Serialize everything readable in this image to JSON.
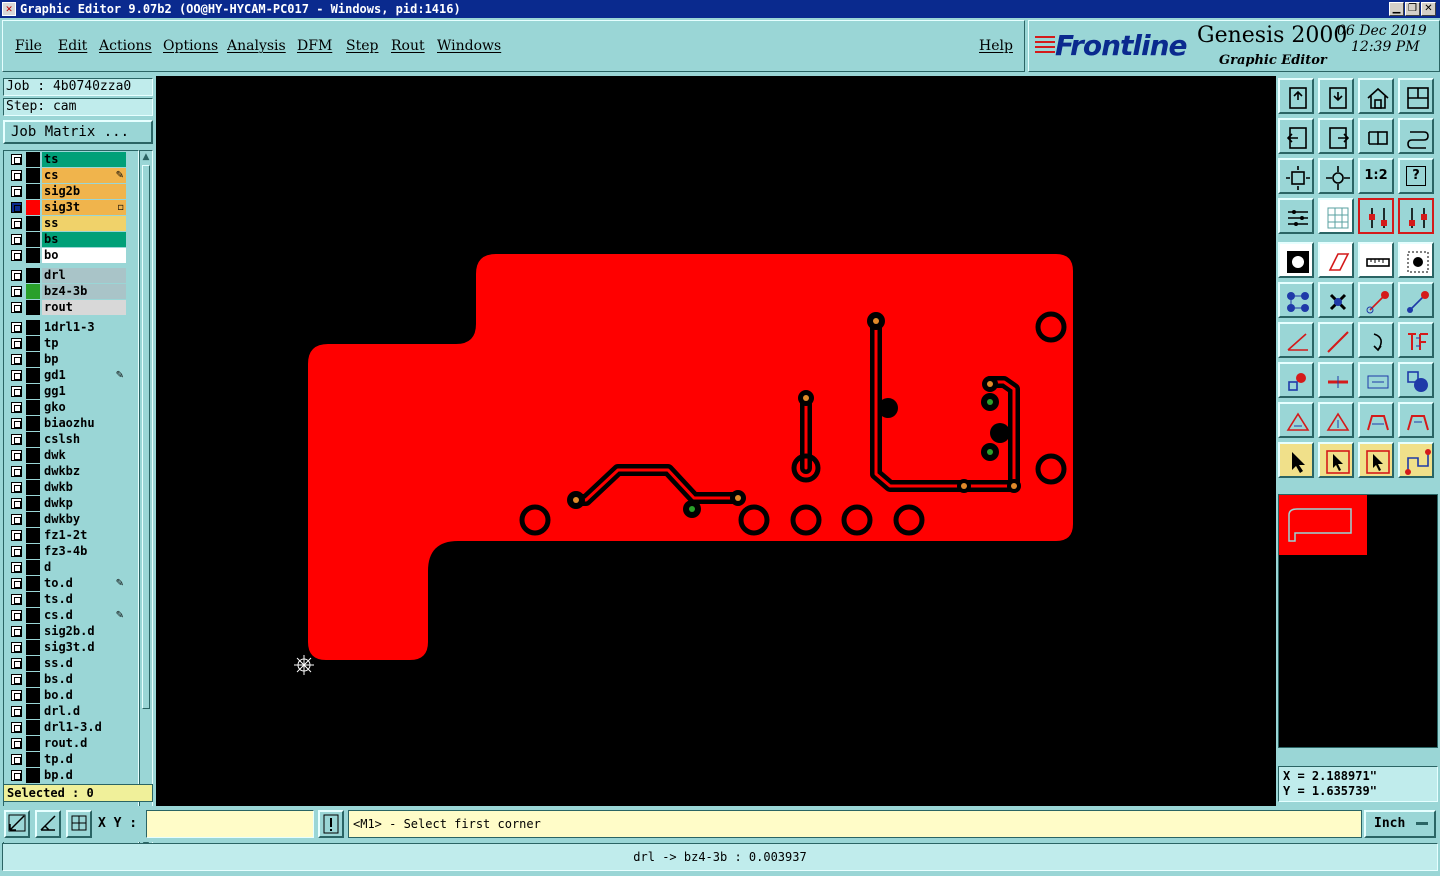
{
  "window": {
    "title": "Graphic Editor 9.07b2 (OO@HY-HYCAM-PC017 - Windows, pid:1416)",
    "buttons": [
      "minimize",
      "restore",
      "close"
    ]
  },
  "menu": {
    "items": [
      "File",
      "Edit",
      "Actions",
      "Options",
      "Analysis",
      "DFM",
      "Step",
      "Rout",
      "Windows"
    ],
    "help": "Help"
  },
  "brand": {
    "logo": "Frontline",
    "product": "Genesis 2000",
    "subtitle": "Graphic Editor",
    "date": "06 Dec 2019",
    "time": "12:39 PM"
  },
  "job": {
    "job_label": "Job : 4b0740zza0",
    "step_label": "Step: cam",
    "matrix_button": "Job Matrix ..."
  },
  "layers": [
    {
      "name": "ts",
      "bg": "#00a078",
      "swatch": "#000000",
      "mark": ""
    },
    {
      "name": "cs",
      "bg": "#f0b44c",
      "swatch": "#000000",
      "mark": "✎"
    },
    {
      "name": "sig2b",
      "bg": "#f0b44c",
      "swatch": "#000000",
      "mark": ""
    },
    {
      "name": "sig3t",
      "bg": "#f0b44c",
      "swatch": "#ff0000",
      "mark": "▫",
      "active": true
    },
    {
      "name": "ss",
      "bg": "#f0d26a",
      "swatch": "#000000",
      "mark": ""
    },
    {
      "name": "bs",
      "bg": "#00a078",
      "swatch": "#000000",
      "mark": ""
    },
    {
      "name": "bo",
      "bg": "#ffffff",
      "swatch": "#000000",
      "mark": ""
    },
    {
      "name": "drl",
      "bg": "#a9c4c8",
      "swatch": "#000000",
      "mark": "",
      "gap": true
    },
    {
      "name": "bz4-3b",
      "bg": "#a9c4c8",
      "swatch": "#2aa02a",
      "mark": ""
    },
    {
      "name": "rout",
      "bg": "#d8d8d8",
      "swatch": "#000000",
      "mark": ""
    },
    {
      "name": "1drl1-3",
      "bg": "#9ad6d6",
      "swatch": "#000000",
      "mark": "",
      "gap": true
    },
    {
      "name": "tp",
      "bg": "#9ad6d6",
      "swatch": "#000000",
      "mark": ""
    },
    {
      "name": "bp",
      "bg": "#9ad6d6",
      "swatch": "#000000",
      "mark": ""
    },
    {
      "name": "gd1",
      "bg": "#9ad6d6",
      "swatch": "#000000",
      "mark": "✎"
    },
    {
      "name": "gg1",
      "bg": "#9ad6d6",
      "swatch": "#000000",
      "mark": ""
    },
    {
      "name": "gko",
      "bg": "#9ad6d6",
      "swatch": "#000000",
      "mark": ""
    },
    {
      "name": "biaozhu",
      "bg": "#9ad6d6",
      "swatch": "#000000",
      "mark": ""
    },
    {
      "name": "cslsh",
      "bg": "#9ad6d6",
      "swatch": "#000000",
      "mark": ""
    },
    {
      "name": "dwk",
      "bg": "#9ad6d6",
      "swatch": "#000000",
      "mark": ""
    },
    {
      "name": "dwkbz",
      "bg": "#9ad6d6",
      "swatch": "#000000",
      "mark": ""
    },
    {
      "name": "dwkb",
      "bg": "#9ad6d6",
      "swatch": "#000000",
      "mark": ""
    },
    {
      "name": "dwkp",
      "bg": "#9ad6d6",
      "swatch": "#000000",
      "mark": ""
    },
    {
      "name": "dwkby",
      "bg": "#9ad6d6",
      "swatch": "#000000",
      "mark": ""
    },
    {
      "name": "fz1-2t",
      "bg": "#9ad6d6",
      "swatch": "#000000",
      "mark": ""
    },
    {
      "name": "fz3-4b",
      "bg": "#9ad6d6",
      "swatch": "#000000",
      "mark": ""
    },
    {
      "name": "d",
      "bg": "#9ad6d6",
      "swatch": "#000000",
      "mark": ""
    },
    {
      "name": "to.d",
      "bg": "#9ad6d6",
      "swatch": "#000000",
      "mark": "✎"
    },
    {
      "name": "ts.d",
      "bg": "#9ad6d6",
      "swatch": "#000000",
      "mark": ""
    },
    {
      "name": "cs.d",
      "bg": "#9ad6d6",
      "swatch": "#000000",
      "mark": "✎"
    },
    {
      "name": "sig2b.d",
      "bg": "#9ad6d6",
      "swatch": "#000000",
      "mark": ""
    },
    {
      "name": "sig3t.d",
      "bg": "#9ad6d6",
      "swatch": "#000000",
      "mark": ""
    },
    {
      "name": "ss.d",
      "bg": "#9ad6d6",
      "swatch": "#000000",
      "mark": ""
    },
    {
      "name": "bs.d",
      "bg": "#9ad6d6",
      "swatch": "#000000",
      "mark": ""
    },
    {
      "name": "bo.d",
      "bg": "#9ad6d6",
      "swatch": "#000000",
      "mark": ""
    },
    {
      "name": "drl.d",
      "bg": "#9ad6d6",
      "swatch": "#000000",
      "mark": ""
    },
    {
      "name": "drl1-3.d",
      "bg": "#9ad6d6",
      "swatch": "#000000",
      "mark": ""
    },
    {
      "name": "rout.d",
      "bg": "#9ad6d6",
      "swatch": "#000000",
      "mark": ""
    },
    {
      "name": "tp.d",
      "bg": "#9ad6d6",
      "swatch": "#000000",
      "mark": ""
    },
    {
      "name": "bp.d",
      "bg": "#9ad6d6",
      "swatch": "#000000",
      "mark": ""
    }
  ],
  "selected_label": "Selected : 0",
  "toolbar": {
    "ratio_label": "1:2",
    "help_label": "?"
  },
  "coords": {
    "x": "X = 2.188971\"",
    "y": "Y = 1.635739\""
  },
  "bottom": {
    "xy_label": "X Y :",
    "xy_value": "",
    "prompt": "<M1> - Select first corner",
    "unit": "Inch"
  },
  "status": "drl -> bz4-3b : 0.003937",
  "colors": {
    "board": "#ff0000",
    "canvas": "#000000",
    "pad_orange": "#e08a2a",
    "pad_green": "#2aa02a",
    "panel": "#9ad6d6"
  }
}
